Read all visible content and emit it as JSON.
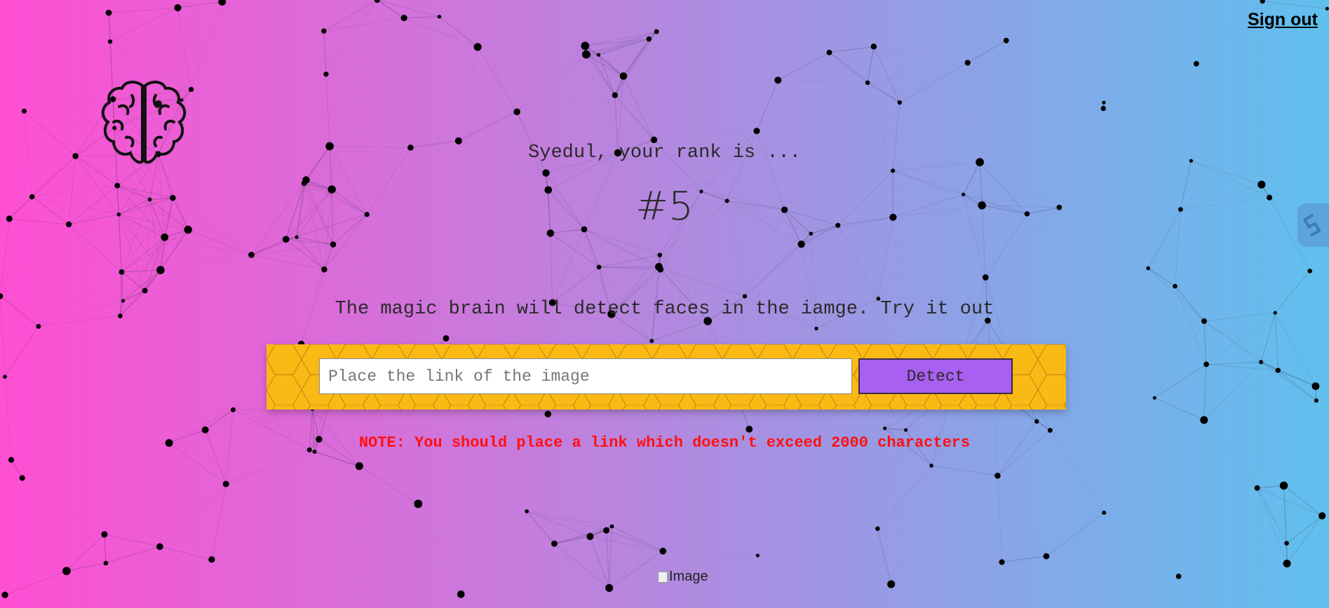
{
  "header": {
    "signout_label": "Sign out"
  },
  "logo": {
    "icon": "brain-icon"
  },
  "side_tab": {
    "icon": "extension-icon"
  },
  "rank": {
    "label": "Syedul, your rank is ...",
    "value": "#5"
  },
  "main": {
    "tagline": "The magic brain will detect faces in the iamge. Try it out",
    "input_placeholder": "Place the link of the image",
    "detect_label": "Detect",
    "note": "NOTE: You should place a link which doesn't exceed 2000 characters"
  },
  "result": {
    "image_alt": "Image"
  },
  "colors": {
    "gradient_left": "#ff4fd3",
    "gradient_right": "#60c0ee",
    "panel": "#fbb916",
    "button": "#a95ff0",
    "note": "#ff1010"
  }
}
